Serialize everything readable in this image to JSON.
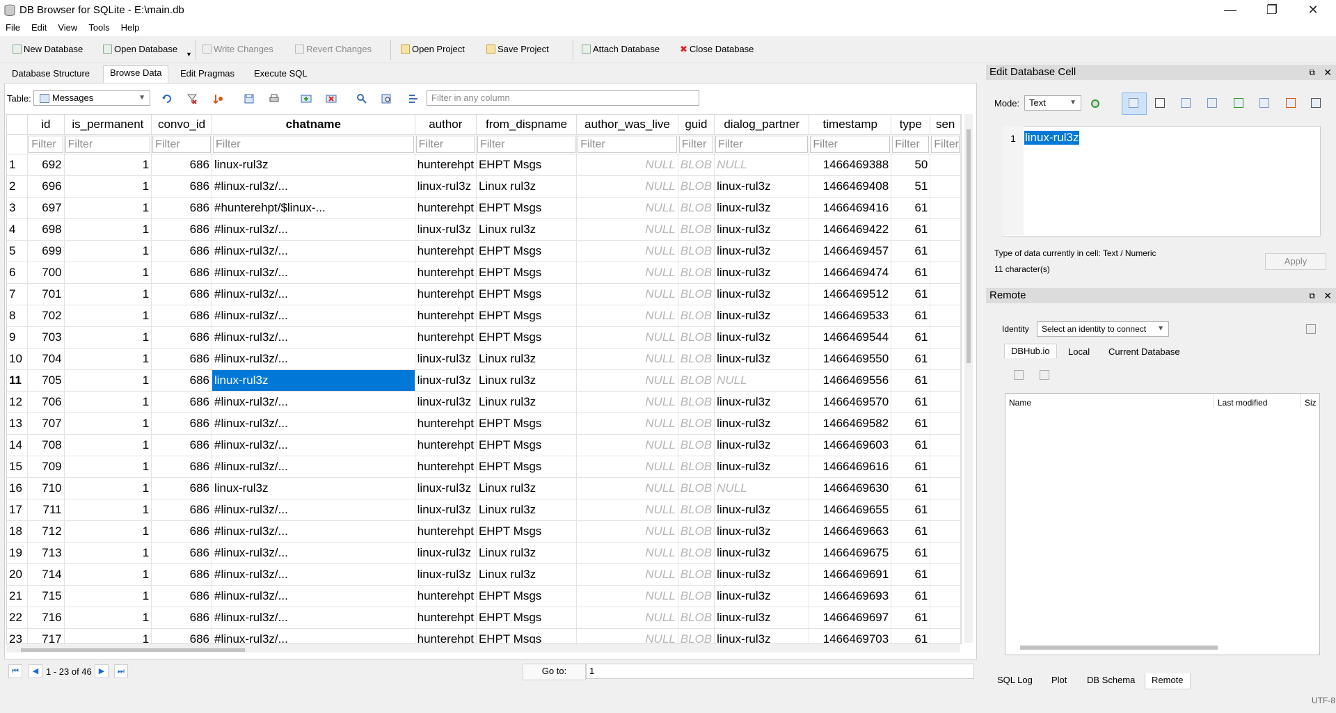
{
  "window": {
    "title": "DB Browser for SQLite - E:\\main.db",
    "minimize": "—",
    "maximize": "❐",
    "close": "✕"
  },
  "menu": [
    "File",
    "Edit",
    "View",
    "Tools",
    "Help"
  ],
  "toolbar": {
    "new_db": "New Database",
    "open_db": "Open Database",
    "write": "Write Changes",
    "revert": "Revert Changes",
    "open_project": "Open Project",
    "save_project": "Save Project",
    "attach": "Attach Database",
    "close_db": "Close Database"
  },
  "tabs": [
    "Database Structure",
    "Browse Data",
    "Edit Pragmas",
    "Execute SQL"
  ],
  "browse": {
    "table_label": "Table:",
    "table_value": "Messages",
    "filter_placeholder": "Filter in any column",
    "filter_text": "Filter"
  },
  "columns": [
    "id",
    "is_permanent",
    "convo_id",
    "chatname",
    "author",
    "from_dispname",
    "author_was_live",
    "guid",
    "dialog_partner",
    "timestamp",
    "type",
    "sen"
  ],
  "rows": [
    [
      "1",
      "692",
      "1",
      "686",
      "linux-rul3z",
      "hunterehpt",
      "EHPT Msgs",
      "NULL",
      "BLOB",
      "NULL",
      "1466469388",
      "50"
    ],
    [
      "2",
      "696",
      "1",
      "686",
      "#linux-rul3z/...",
      "linux-rul3z",
      "Linux rul3z",
      "NULL",
      "BLOB",
      "linux-rul3z",
      "1466469408",
      "51"
    ],
    [
      "3",
      "697",
      "1",
      "686",
      "#hunterehpt/$linux-...",
      "hunterehpt",
      "EHPT Msgs",
      "NULL",
      "BLOB",
      "linux-rul3z",
      "1466469416",
      "61"
    ],
    [
      "4",
      "698",
      "1",
      "686",
      "#linux-rul3z/...",
      "linux-rul3z",
      "Linux rul3z",
      "NULL",
      "BLOB",
      "linux-rul3z",
      "1466469422",
      "61"
    ],
    [
      "5",
      "699",
      "1",
      "686",
      "#linux-rul3z/...",
      "hunterehpt",
      "EHPT Msgs",
      "NULL",
      "BLOB",
      "linux-rul3z",
      "1466469457",
      "61"
    ],
    [
      "6",
      "700",
      "1",
      "686",
      "#linux-rul3z/...",
      "hunterehpt",
      "EHPT Msgs",
      "NULL",
      "BLOB",
      "linux-rul3z",
      "1466469474",
      "61"
    ],
    [
      "7",
      "701",
      "1",
      "686",
      "#linux-rul3z/...",
      "hunterehpt",
      "EHPT Msgs",
      "NULL",
      "BLOB",
      "linux-rul3z",
      "1466469512",
      "61"
    ],
    [
      "8",
      "702",
      "1",
      "686",
      "#linux-rul3z/...",
      "hunterehpt",
      "EHPT Msgs",
      "NULL",
      "BLOB",
      "linux-rul3z",
      "1466469533",
      "61"
    ],
    [
      "9",
      "703",
      "1",
      "686",
      "#linux-rul3z/...",
      "hunterehpt",
      "EHPT Msgs",
      "NULL",
      "BLOB",
      "linux-rul3z",
      "1466469544",
      "61"
    ],
    [
      "10",
      "704",
      "1",
      "686",
      "#linux-rul3z/...",
      "linux-rul3z",
      "Linux rul3z",
      "NULL",
      "BLOB",
      "linux-rul3z",
      "1466469550",
      "61"
    ],
    [
      "11",
      "705",
      "1",
      "686",
      "linux-rul3z",
      "linux-rul3z",
      "Linux rul3z",
      "NULL",
      "BLOB",
      "NULL",
      "1466469556",
      "61"
    ],
    [
      "12",
      "706",
      "1",
      "686",
      "#linux-rul3z/...",
      "linux-rul3z",
      "Linux rul3z",
      "NULL",
      "BLOB",
      "linux-rul3z",
      "1466469570",
      "61"
    ],
    [
      "13",
      "707",
      "1",
      "686",
      "#linux-rul3z/...",
      "hunterehpt",
      "EHPT Msgs",
      "NULL",
      "BLOB",
      "linux-rul3z",
      "1466469582",
      "61"
    ],
    [
      "14",
      "708",
      "1",
      "686",
      "#linux-rul3z/...",
      "hunterehpt",
      "EHPT Msgs",
      "NULL",
      "BLOB",
      "linux-rul3z",
      "1466469603",
      "61"
    ],
    [
      "15",
      "709",
      "1",
      "686",
      "#linux-rul3z/...",
      "hunterehpt",
      "EHPT Msgs",
      "NULL",
      "BLOB",
      "linux-rul3z",
      "1466469616",
      "61"
    ],
    [
      "16",
      "710",
      "1",
      "686",
      "linux-rul3z",
      "linux-rul3z",
      "Linux rul3z",
      "NULL",
      "BLOB",
      "NULL",
      "1466469630",
      "61"
    ],
    [
      "17",
      "711",
      "1",
      "686",
      "#linux-rul3z/...",
      "linux-rul3z",
      "Linux rul3z",
      "NULL",
      "BLOB",
      "linux-rul3z",
      "1466469655",
      "61"
    ],
    [
      "18",
      "712",
      "1",
      "686",
      "#linux-rul3z/...",
      "hunterehpt",
      "EHPT Msgs",
      "NULL",
      "BLOB",
      "linux-rul3z",
      "1466469663",
      "61"
    ],
    [
      "19",
      "713",
      "1",
      "686",
      "#linux-rul3z/...",
      "linux-rul3z",
      "Linux rul3z",
      "NULL",
      "BLOB",
      "linux-rul3z",
      "1466469675",
      "61"
    ],
    [
      "20",
      "714",
      "1",
      "686",
      "#linux-rul3z/...",
      "linux-rul3z",
      "Linux rul3z",
      "NULL",
      "BLOB",
      "linux-rul3z",
      "1466469691",
      "61"
    ],
    [
      "21",
      "715",
      "1",
      "686",
      "#linux-rul3z/...",
      "hunterehpt",
      "EHPT Msgs",
      "NULL",
      "BLOB",
      "linux-rul3z",
      "1466469693",
      "61"
    ],
    [
      "22",
      "716",
      "1",
      "686",
      "#linux-rul3z/...",
      "hunterehpt",
      "EHPT Msgs",
      "NULL",
      "BLOB",
      "linux-rul3z",
      "1466469697",
      "61"
    ],
    [
      "23",
      "717",
      "1",
      "686",
      "#linux-rul3z/...",
      "hunterehpt",
      "EHPT Msgs",
      "NULL",
      "BLOB",
      "linux-rul3z",
      "1466469703",
      "61"
    ]
  ],
  "selected_row": "11",
  "nav": {
    "range": "1 - 23 of 46",
    "goto_label": "Go to:",
    "goto_value": "1"
  },
  "edit_cell": {
    "title": "Edit Database Cell",
    "mode_label": "Mode:",
    "mode_value": "Text",
    "line_number": "1",
    "value": "linux-rul3z",
    "type_info": "Type of data currently in cell: Text / Numeric",
    "char_info": "11 character(s)",
    "apply": "Apply"
  },
  "remote": {
    "title": "Remote",
    "identity_label": "Identity",
    "identity_value": "Select an identity to connect",
    "tabs": [
      "DBHub.io",
      "Local",
      "Current Database"
    ],
    "columns": [
      "Name",
      "Last modified",
      "Siz"
    ]
  },
  "bottom_tabs": [
    "SQL Log",
    "Plot",
    "DB Schema",
    "Remote"
  ],
  "status": {
    "encoding": "UTF-8"
  },
  "colors": {
    "selection": "#0078d7",
    "null_text": "#b5b5b5"
  }
}
